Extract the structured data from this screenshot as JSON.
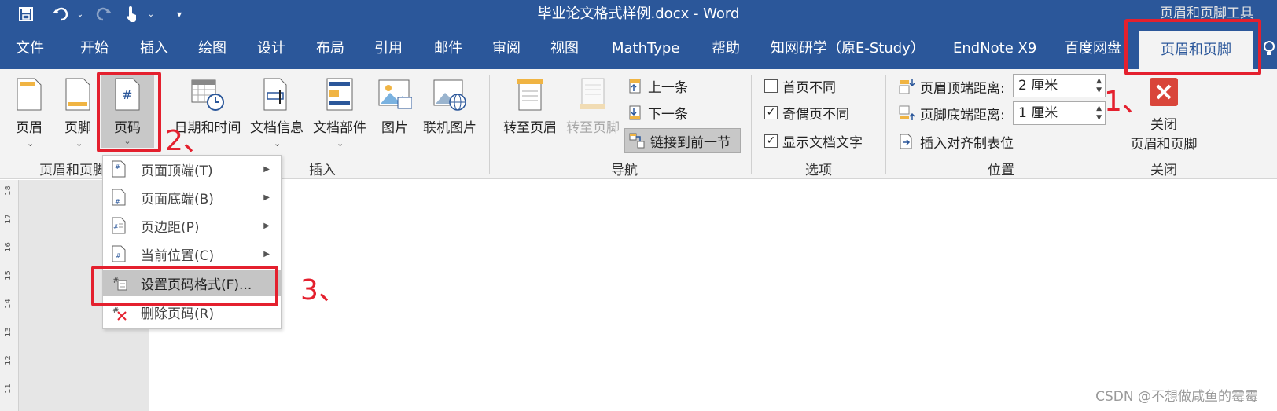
{
  "window": {
    "title": "毕业论文格式样例.docx  -  Word",
    "context_tools": "页眉和页脚工具",
    "qat": [
      "save-icon",
      "undo-icon",
      "redo-icon",
      "touch-mode-icon",
      "customize-qat-icon"
    ]
  },
  "tabs": [
    {
      "label": "文件"
    },
    {
      "label": "开始"
    },
    {
      "label": "插入"
    },
    {
      "label": "绘图"
    },
    {
      "label": "设计"
    },
    {
      "label": "布局"
    },
    {
      "label": "引用"
    },
    {
      "label": "邮件"
    },
    {
      "label": "审阅"
    },
    {
      "label": "视图"
    },
    {
      "label": "MathType"
    },
    {
      "label": "帮助"
    },
    {
      "label": "知网研学（原E-Study）"
    },
    {
      "label": "EndNote X9"
    },
    {
      "label": "百度网盘"
    },
    {
      "label": "页眉和页脚"
    }
  ],
  "ribbon": {
    "hf_group": {
      "label": "页眉和页脚",
      "header": "页眉",
      "footer": "页脚",
      "page_number": "页码"
    },
    "insert_group": {
      "label": "插入",
      "datetime": "日期和时间",
      "docinfo": "文档信息",
      "quickparts": "文档部件",
      "picture": "图片",
      "online_picture": "联机图片"
    },
    "nav_group": {
      "label": "导航",
      "goto_header": "转至页眉",
      "goto_footer": "转至页脚",
      "previous": "上一条",
      "next": "下一条",
      "link_previous": "链接到前一节"
    },
    "options_group": {
      "label": "选项",
      "diff_first": "首页不同",
      "diff_odd_even": "奇偶页不同",
      "show_doc_text": "显示文档文字",
      "diff_first_checked": false,
      "diff_odd_even_checked": true,
      "show_doc_text_checked": true
    },
    "position_group": {
      "label": "位置",
      "header_top": "页眉顶端距离:",
      "header_top_value": "2 厘米",
      "footer_bottom": "页脚底端距离:",
      "footer_bottom_value": "1 厘米",
      "insert_align_tab": "插入对齐制表位"
    },
    "close_group": {
      "label": "关闭",
      "close_line1": "关闭",
      "close_line2": "页眉和页脚"
    }
  },
  "menu": {
    "items": [
      {
        "label": "页面顶端(T)",
        "submenu": true
      },
      {
        "label": "页面底端(B)",
        "submenu": true
      },
      {
        "label": "页边距(P)",
        "submenu": true
      },
      {
        "label": "当前位置(C)",
        "submenu": true
      },
      {
        "label": "设置页码格式(F)...",
        "submenu": false
      },
      {
        "label": "删除页码(R)",
        "submenu": false
      }
    ]
  },
  "ruler": [
    "18",
    "17",
    "16",
    "15",
    "14",
    "13",
    "12",
    "11"
  ],
  "annotations": {
    "step1": "1、",
    "step2": "2、",
    "step3": "3、"
  },
  "watermark": "CSDN @不想做咸鱼的霉霉",
  "colors": {
    "accent": "#2b579a",
    "annotation_red": "#e4202e",
    "close_red": "#d9453a"
  }
}
